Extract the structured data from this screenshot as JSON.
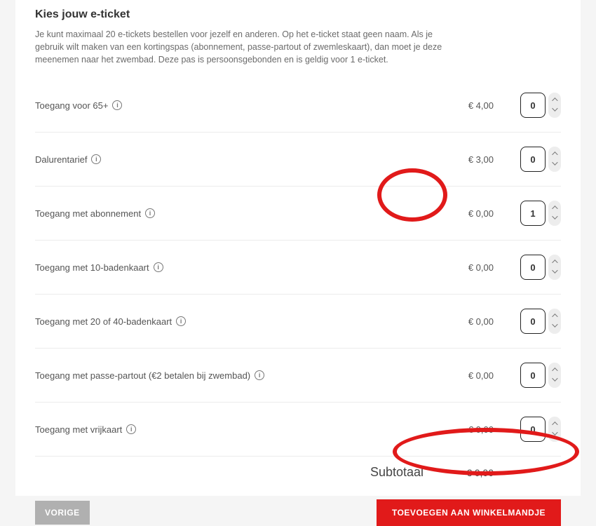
{
  "header": {
    "title": "Kies jouw e-ticket",
    "description": "Je kunt maximaal 20 e-tickets bestellen voor jezelf en anderen. Op het e-ticket staat geen naam. Als je gebruik wilt maken van een kortingspas (abonnement, passe-partout of zwemleskaart), dan moet je deze meenemen naar het zwembad. Deze pas is persoonsgebonden en is geldig voor 1 e-ticket."
  },
  "tickets": [
    {
      "label": "Toegang voor 65+",
      "price": "€ 4,00",
      "qty": "0"
    },
    {
      "label": "Dalurentarief",
      "price": "€ 3,00",
      "qty": "0"
    },
    {
      "label": "Toegang met abonnement",
      "price": "€ 0,00",
      "qty": "1"
    },
    {
      "label": "Toegang met 10-badenkaart",
      "price": "€ 0,00",
      "qty": "0"
    },
    {
      "label": "Toegang met 20 of 40-badenkaart",
      "price": "€ 0,00",
      "qty": "0"
    },
    {
      "label": "Toegang met passe-partout (€2 betalen bij zwembad)",
      "price": "€ 0,00",
      "qty": "0"
    },
    {
      "label": "Toegang met vrijkaart",
      "price": "€ 0,00",
      "qty": "0"
    }
  ],
  "subtotal": {
    "label": "Subtotaal",
    "value": "€ 0,00"
  },
  "actions": {
    "previous": "VORIGE",
    "add_to_cart": "TOEVOEGEN AAN WINKELMANDJE"
  }
}
